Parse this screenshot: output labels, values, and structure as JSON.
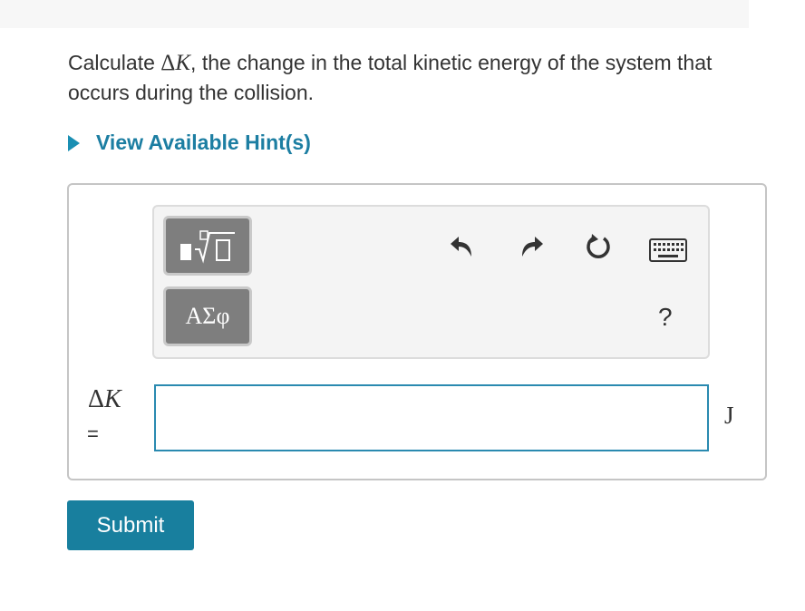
{
  "question": {
    "prefix": "Calculate ",
    "delta": "Δ",
    "var": "K",
    "suffix": ", the change in the total kinetic energy of the system that occurs during the collision."
  },
  "hint": {
    "label": "View Available Hint(s)"
  },
  "toolbar": {
    "template_button_icon": "fraction-root-template-icon",
    "greek_button_label": "ΑΣφ",
    "undo_icon": "undo-icon",
    "redo_icon": "redo-icon",
    "reset_icon": "reset-icon",
    "keyboard_icon": "keyboard-icon",
    "help_label": "?"
  },
  "answer": {
    "label_delta": "Δ",
    "label_var": "K",
    "equals": "=",
    "value": "",
    "unit": "J"
  },
  "submit": {
    "label": "Submit"
  },
  "colors": {
    "accent": "#187f9e",
    "link": "#1c7ea2",
    "toolbar_button": "#7e7e7e",
    "input_border": "#2a8ab0"
  }
}
